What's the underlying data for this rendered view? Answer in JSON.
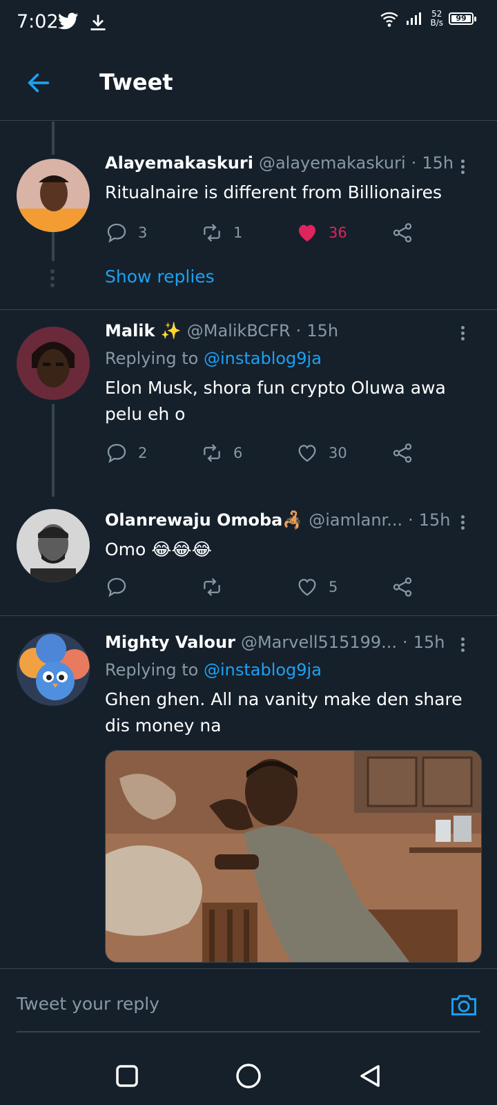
{
  "status_bar": {
    "time": "7:02",
    "speed_value": "52",
    "speed_unit": "B/s",
    "battery": "99"
  },
  "header": {
    "title": "Tweet"
  },
  "tweets": [
    {
      "name": "Alayemakaskuri",
      "handle": "@alayemakaskuri",
      "time": "15h",
      "text": "Ritualnaire is different from Billionaires",
      "replies": "3",
      "retweets": "1",
      "likes": "36",
      "liked": true,
      "show_replies": "Show replies"
    },
    {
      "name": "Malik ✨",
      "handle": "@MalikBCFR",
      "time": "15h",
      "replying_prefix": "Replying to",
      "replying_to": "@instablog9ja",
      "text": "Elon Musk, shora fun crypto Oluwa awa pelu eh o",
      "replies": "2",
      "retweets": "6",
      "likes": "30"
    },
    {
      "name": "Olanrewaju Omoba🦂",
      "handle": "@iamlanr...",
      "time": "15h",
      "text": "Omo 😂😂😂",
      "replies": "",
      "retweets": "",
      "likes": "5"
    },
    {
      "name": "Mighty Valour",
      "handle": "@Marvell515199...",
      "time": "15h",
      "replying_prefix": "Replying to",
      "replying_to": "@instablog9ja",
      "text": "Ghen ghen. All na vanity make den share dis money na"
    }
  ],
  "reply_bar": {
    "placeholder": "Tweet your reply"
  },
  "colors": {
    "background": "#15202b",
    "accent": "#1da1f2",
    "like": "#e0245e",
    "muted": "#8899a6",
    "border": "#38444d"
  }
}
